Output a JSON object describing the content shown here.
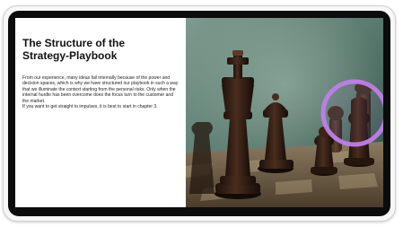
{
  "slide": {
    "title": "The Structure of the Strategy-Playbook",
    "paragraphs": [
      "From our experience, many ideas fail internally because of the power and decision spaces, which is why we have structured our playbook in such a way that we illuminate the context starting from the personal risks. Only when the internal hurdle has been overcome does the focus turn to the customer and the market.",
      "If you want to get straight to impulses, it is best to start in chapter 3."
    ]
  },
  "image": {
    "subject": "chess-pieces-photo",
    "highlight_color": "#c07ee8"
  },
  "colors": {
    "frame": "#f7f7f8",
    "bezel": "#0c0c0d",
    "text": "#111111"
  }
}
